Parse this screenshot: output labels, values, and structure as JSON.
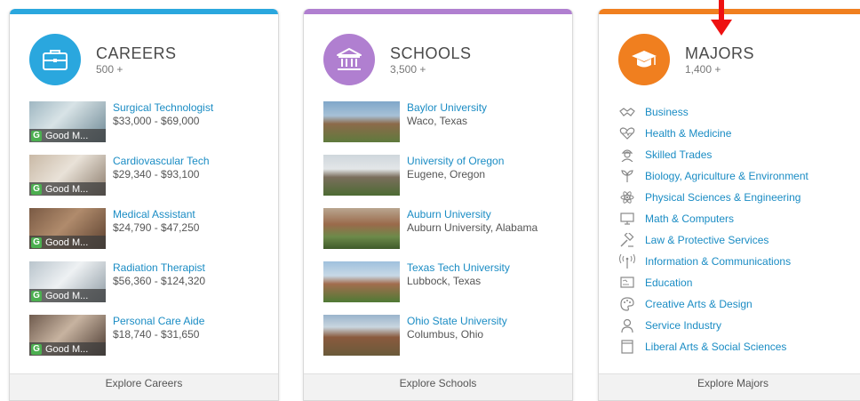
{
  "colors": {
    "careers": "#2aa7de",
    "schools": "#b07fd0",
    "majors": "#f07f1f",
    "link": "#1a8cc4",
    "arrow": "#ee1111"
  },
  "careers": {
    "title": "CAREERS",
    "count": "500 +",
    "icon": "briefcase-icon",
    "badge_text": "Good M...",
    "items": [
      {
        "title": "Surgical Technologist",
        "salary": "$33,000 - $69,000"
      },
      {
        "title": "Cardiovascular Tech",
        "salary": "$29,340 - $93,100"
      },
      {
        "title": "Medical Assistant",
        "salary": "$24,790 - $47,250"
      },
      {
        "title": "Radiation Therapist",
        "salary": "$56,360 - $124,320"
      },
      {
        "title": "Personal Care Aide",
        "salary": "$18,740 - $31,650"
      }
    ],
    "footer": "Explore Careers"
  },
  "schools": {
    "title": "SCHOOLS",
    "count": "3,500 +",
    "icon": "institution-icon",
    "items": [
      {
        "name": "Baylor University",
        "location": "Waco, Texas"
      },
      {
        "name": "University of Oregon",
        "location": "Eugene, Oregon"
      },
      {
        "name": "Auburn University",
        "location": "Auburn University, Alabama"
      },
      {
        "name": "Texas Tech University",
        "location": "Lubbock, Texas"
      },
      {
        "name": "Ohio State University",
        "location": "Columbus, Ohio"
      }
    ],
    "footer": "Explore Schools"
  },
  "majors": {
    "title": "MAJORS",
    "count": "1,400 +",
    "icon": "graduation-cap-icon",
    "items": [
      {
        "label": "Business",
        "icon": "handshake-icon"
      },
      {
        "label": "Health & Medicine",
        "icon": "heart-pulse-icon"
      },
      {
        "label": "Skilled Trades",
        "icon": "worker-icon"
      },
      {
        "label": "Biology, Agriculture & Environment",
        "icon": "plant-icon"
      },
      {
        "label": "Physical Sciences & Engineering",
        "icon": "atom-icon"
      },
      {
        "label": "Math & Computers",
        "icon": "computer-icon"
      },
      {
        "label": "Law & Protective Services",
        "icon": "gavel-icon"
      },
      {
        "label": "Information & Communications",
        "icon": "antenna-icon"
      },
      {
        "label": "Education",
        "icon": "chalkboard-icon"
      },
      {
        "label": "Creative Arts & Design",
        "icon": "palette-icon"
      },
      {
        "label": "Service Industry",
        "icon": "person-service-icon"
      },
      {
        "label": "Liberal Arts & Social Sciences",
        "icon": "book-icon"
      }
    ],
    "footer": "Explore Majors"
  }
}
